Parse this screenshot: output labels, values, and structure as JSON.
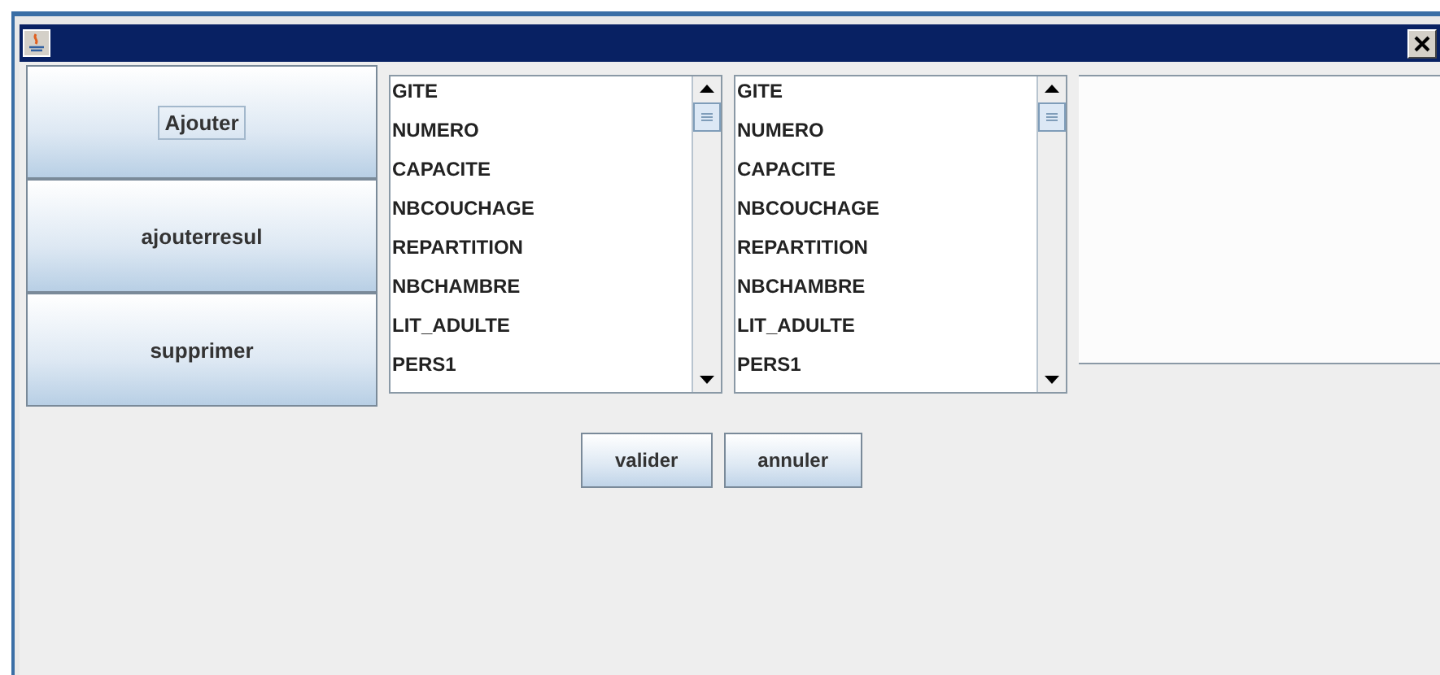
{
  "side_buttons": [
    {
      "label": "Ajouter",
      "focused": true
    },
    {
      "label": "ajouterresul",
      "focused": false
    },
    {
      "label": "supprimer",
      "focused": false
    }
  ],
  "lists": [
    {
      "items": [
        "GITE",
        "NUMERO",
        "CAPACITE",
        "NBCOUCHAGE",
        "REPARTITION",
        "NBCHAMBRE",
        "LIT_ADULTE",
        "PERS1"
      ]
    },
    {
      "items": [
        "GITE",
        "NUMERO",
        "CAPACITE",
        "NBCOUCHAGE",
        "REPARTITION",
        "NBCHAMBRE",
        "LIT_ADULTE",
        "PERS1"
      ]
    }
  ],
  "actions": [
    "valider",
    "annuler"
  ]
}
